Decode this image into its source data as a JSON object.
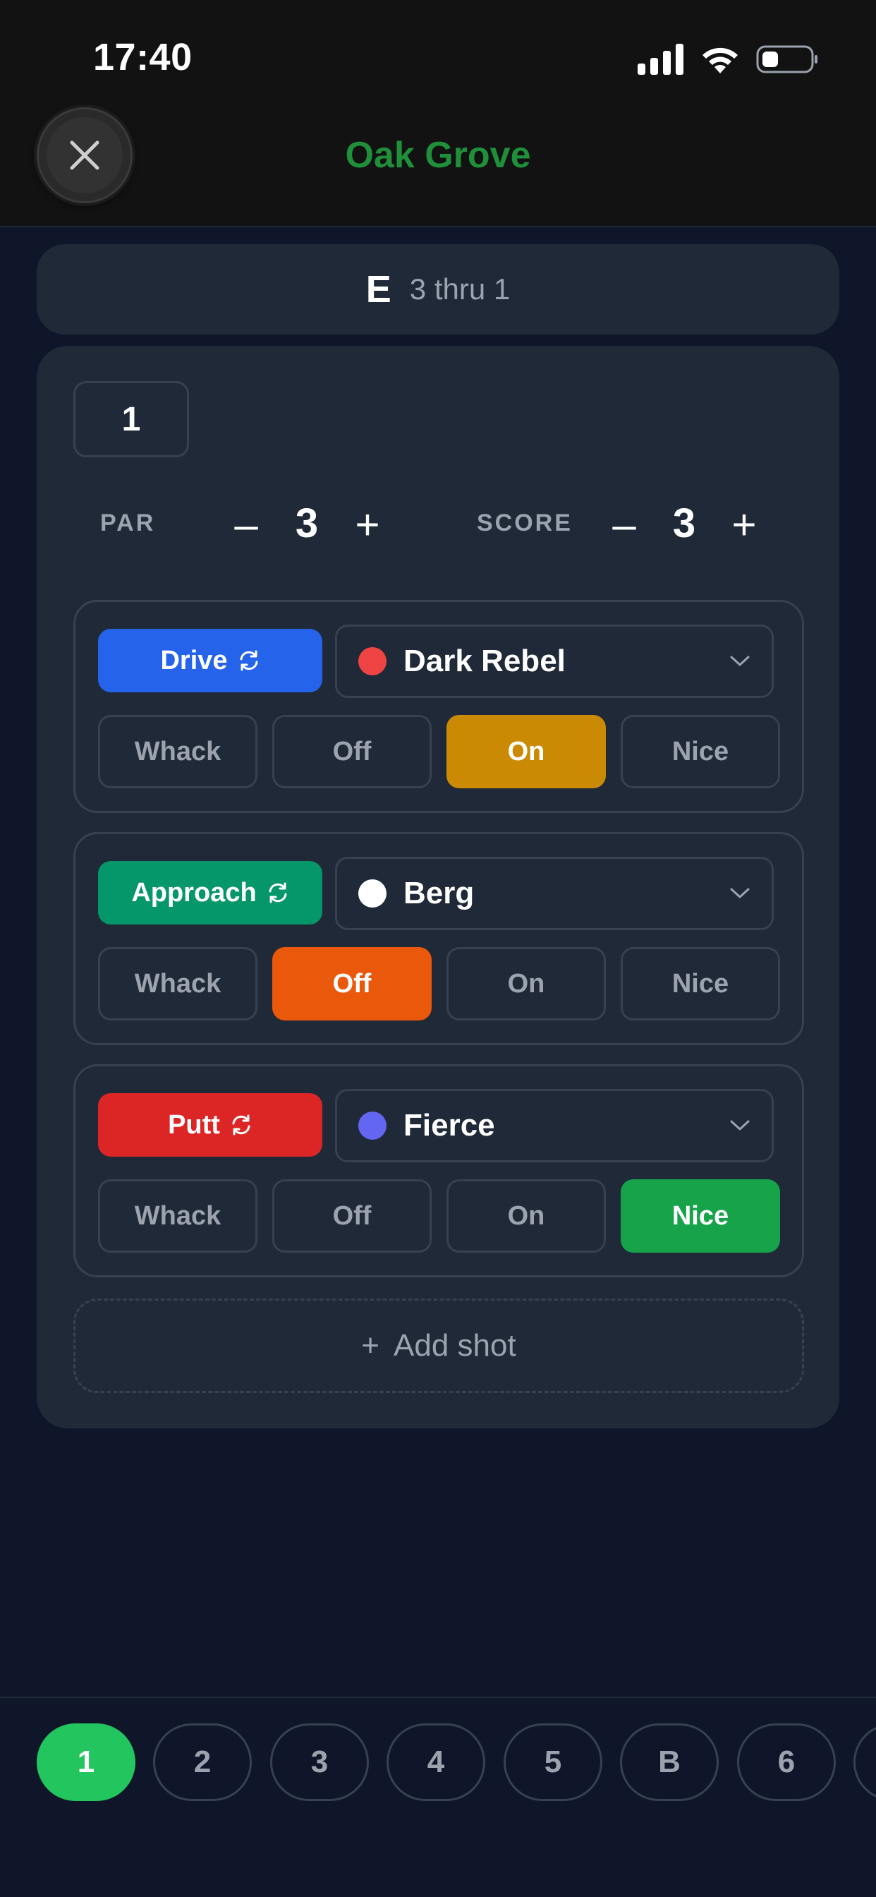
{
  "status_bar": {
    "time": "17:40"
  },
  "header": {
    "title": "Oak Grove"
  },
  "summary": {
    "score": "E",
    "thru": "3 thru 1"
  },
  "hole": {
    "number": "1",
    "par": {
      "label": "PAR",
      "value": "3",
      "minus": "–",
      "plus": "+"
    },
    "score": {
      "label": "SCORE",
      "value": "3",
      "minus": "–",
      "plus": "+"
    }
  },
  "shots": [
    {
      "type": "Drive",
      "type_color": "#2563eb",
      "disc": "Dark Rebel",
      "disc_color": "#ef4444",
      "results": [
        "Whack",
        "Off",
        "On",
        "Nice"
      ],
      "selected": 2,
      "selected_color": "#ca8a04"
    },
    {
      "type": "Approach",
      "type_color": "#059669",
      "disc": "Berg",
      "disc_color": "#ffffff",
      "results": [
        "Whack",
        "Off",
        "On",
        "Nice"
      ],
      "selected": 1,
      "selected_color": "#ea580c"
    },
    {
      "type": "Putt",
      "type_color": "#dc2626",
      "disc": "Fierce",
      "disc_color": "#6366f1",
      "results": [
        "Whack",
        "Off",
        "On",
        "Nice"
      ],
      "selected": 3,
      "selected_color": "#16a34a"
    }
  ],
  "add_shot": {
    "icon": "+",
    "label": "Add shot"
  },
  "hole_nav": {
    "items": [
      "1",
      "2",
      "3",
      "4",
      "5",
      "B",
      "6"
    ],
    "active": 0
  },
  "colors": {
    "active_hole": "#22c55e",
    "course_title": "#1f8f3a"
  }
}
